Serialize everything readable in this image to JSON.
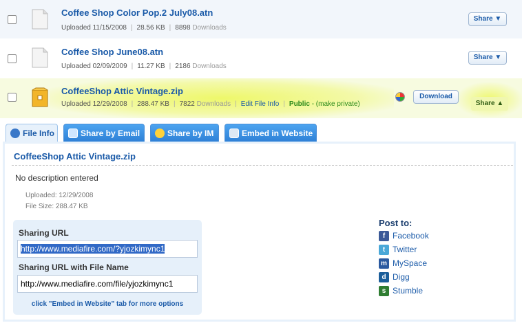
{
  "files": [
    {
      "name": "Coffee Shop Color Pop.2 July08.atn",
      "uploaded": "Uploaded 11/15/2008",
      "size": "28.56 KB",
      "downloads_count": "8898",
      "downloads_label": "Downloads",
      "share": "Share ▼"
    },
    {
      "name": "Coffee Shop June08.atn",
      "uploaded": "Uploaded 02/09/2009",
      "size": "11.27 KB",
      "downloads_count": "2186",
      "downloads_label": "Downloads",
      "share": "Share ▼"
    },
    {
      "name": "CoffeeShop Attic Vintage.zip",
      "uploaded": "Uploaded 12/29/2008",
      "size": "288.47 KB",
      "downloads_count": "7822",
      "downloads_label": "Downloads",
      "edit": "Edit File Info",
      "public": "Public",
      "make_private": "- (make private)",
      "download": "Download",
      "share": "Share ▲"
    }
  ],
  "tabs": [
    {
      "label": "File Info",
      "icon": "info-icon"
    },
    {
      "label": "Share by Email",
      "icon": "email-icon"
    },
    {
      "label": "Share by IM",
      "icon": "im-icon"
    },
    {
      "label": "Embed in Website",
      "icon": "embed-icon"
    }
  ],
  "panel": {
    "title": "CoffeeShop Attic Vintage.zip",
    "description": "No description entered",
    "uploaded": "Uploaded: 12/29/2008",
    "filesize": "File Size: 288.47 KB",
    "sharing_url_label": "Sharing URL",
    "sharing_url": "http://www.mediafire.com/?yjozkimync1",
    "sharing_url_name_label": "Sharing URL with File Name",
    "sharing_url_name": "http://www.mediafire.com/file/yjozkimync1",
    "embed_hint": "click \"Embed in Website\" tab for more options"
  },
  "post_to": {
    "label": "Post to:",
    "items": [
      {
        "label": "Facebook",
        "icon": "facebook-icon",
        "color": "#3b5998"
      },
      {
        "label": "Twitter",
        "icon": "twitter-icon",
        "color": "#4aa8d8"
      },
      {
        "label": "MySpace",
        "icon": "myspace-icon",
        "color": "#2b5aa0"
      },
      {
        "label": "Digg",
        "icon": "digg-icon",
        "color": "#1b5e9a"
      },
      {
        "label": "Stumble",
        "icon": "stumbleupon-icon",
        "color": "#2f7d32"
      }
    ]
  }
}
